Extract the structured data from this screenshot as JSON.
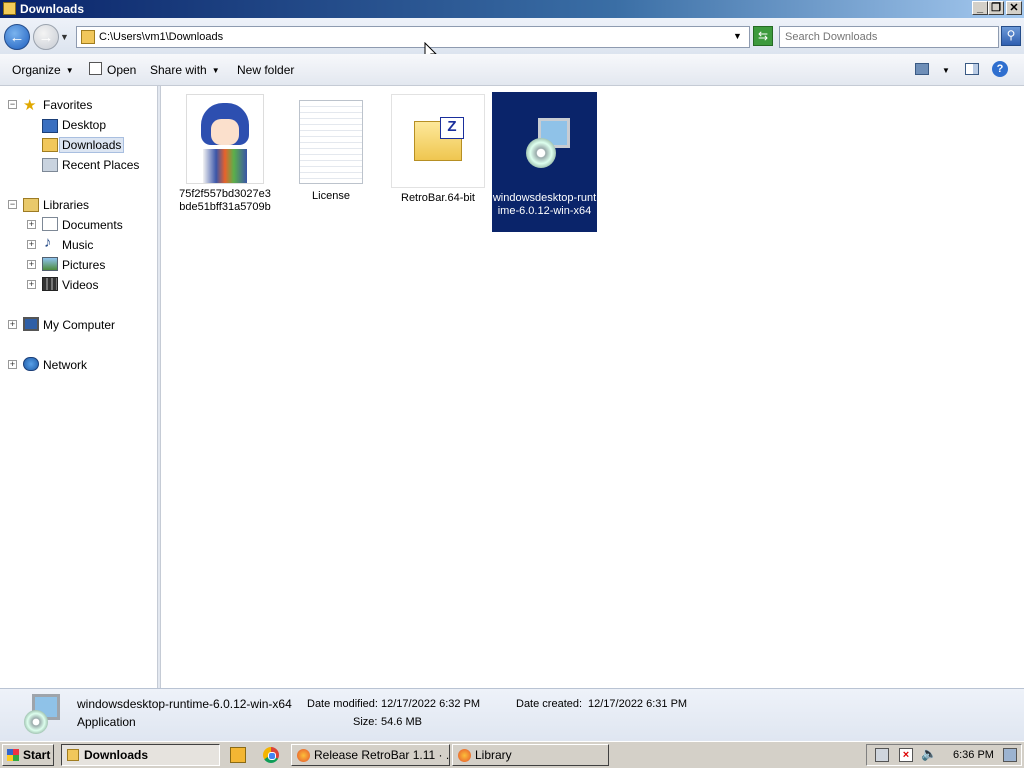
{
  "window": {
    "title": "Downloads"
  },
  "address": {
    "path": "C:\\Users\\vm1\\Downloads"
  },
  "search": {
    "placeholder": "Search Downloads"
  },
  "toolbar": {
    "organize": "Organize",
    "open": "Open",
    "share_with": "Share with",
    "new_folder": "New folder"
  },
  "nav": {
    "favorites": {
      "label": "Favorites",
      "items": [
        "Desktop",
        "Downloads",
        "Recent Places"
      ],
      "selected": "Downloads"
    },
    "libraries": {
      "label": "Libraries",
      "items": [
        "Documents",
        "Music",
        "Pictures",
        "Videos"
      ]
    },
    "computer": "My Computer",
    "network": "Network"
  },
  "files": [
    {
      "name": "75f2f557bd3027e3bde51bff31a5709b",
      "icon": "image-thumbnail"
    },
    {
      "name": "License",
      "icon": "text-document-icon"
    },
    {
      "name": "RetroBar.64-bit",
      "icon": "zip-folder-icon"
    },
    {
      "name": "windowsdesktop-runtime-6.0.12-win-x64",
      "icon": "installer-icon",
      "selected": true
    }
  ],
  "details": {
    "name": "windowsdesktop-runtime-6.0.12-win-x64",
    "type": "Application",
    "modified_label": "Date modified:",
    "modified": "12/17/2022 6:32 PM",
    "size_label": "Size:",
    "size": "54.6 MB",
    "created_label": "Date created:",
    "created": "12/17/2022 6:31 PM"
  },
  "taskbar": {
    "start": "Start",
    "tasks": [
      {
        "label": "Downloads",
        "active": true
      },
      {
        "label": "Release RetroBar 1.11 · ..."
      },
      {
        "label": "Library"
      }
    ],
    "clock": "6:36 PM"
  },
  "colors": {
    "selection": "#0a246a",
    "titlebar": "#0a246a",
    "taskbar": "#d4d0c8"
  }
}
